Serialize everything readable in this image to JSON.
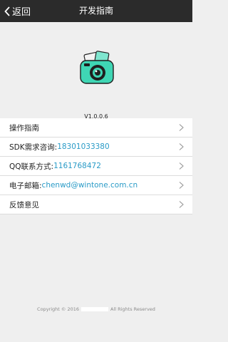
{
  "header": {
    "back_label": "返回",
    "title": "开发指南"
  },
  "app": {
    "version": "V1.0.0.6"
  },
  "menu": [
    {
      "label": "操作指南",
      "value": ""
    },
    {
      "label": "SDK需求咨询:",
      "value": "18301033380"
    },
    {
      "label": "QQ联系方式:",
      "value": "1161768472"
    },
    {
      "label": "电子邮箱:",
      "value": "chenwd@wintone.com.cn"
    },
    {
      "label": "反馈意见",
      "value": ""
    }
  ],
  "footer": {
    "copyright_prefix": "Copyright © 2016",
    "copyright_suffix": "All Rights Reserved"
  },
  "colors": {
    "header_bg": "#2b2b2b",
    "link": "#2a9bc7",
    "icon_teal": "#3fd6b4"
  }
}
